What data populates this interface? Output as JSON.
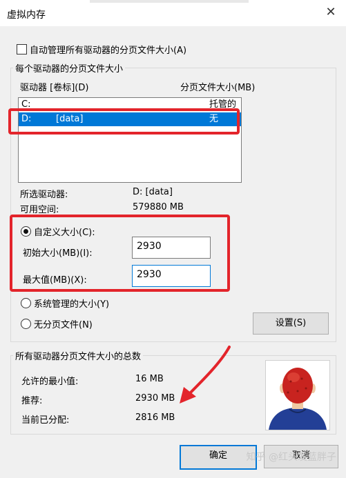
{
  "window": {
    "title": "虚拟内存",
    "close_glyph": "✕"
  },
  "auto_manage": {
    "label": "自动管理所有驱动器的分页文件大小(A)",
    "checked": false
  },
  "per_drive_group": {
    "title": "每个驱动器的分页文件大小",
    "columns": {
      "drive": "驱动器 [卷标](D)",
      "size": "分页文件大小(MB)"
    },
    "drives": [
      {
        "drive": "C:",
        "label": "",
        "size": "托管的系统",
        "selected": false
      },
      {
        "drive": "D:",
        "label": "[data]",
        "size": "无",
        "selected": true
      }
    ],
    "selected_drive": {
      "label": "所选驱动器:",
      "value": "D:  [data]"
    },
    "free_space": {
      "label": "可用空间:",
      "value": "579880 MB"
    },
    "custom_size": {
      "label": "自定义大小(C):",
      "checked": true
    },
    "initial_size": {
      "label": "初始大小(MB)(I):",
      "value": "2930"
    },
    "max_size": {
      "label": "最大值(MB)(X):",
      "value": "2930"
    },
    "system_managed": {
      "label": "系统管理的大小(Y)",
      "checked": false
    },
    "no_paging": {
      "label": "无分页文件(N)",
      "checked": false
    },
    "set_button": "设置(S)"
  },
  "totals_group": {
    "title": "所有驱动器分页文件大小的总数",
    "min_allowed": {
      "label": "允许的最小值:",
      "value": "16 MB"
    },
    "recommended": {
      "label": "推荐:",
      "value": "2930 MB"
    },
    "allocated": {
      "label": "当前已分配:",
      "value": "2816 MB"
    }
  },
  "buttons": {
    "ok": "确定",
    "cancel": "取消"
  },
  "watermark": "知乎 @红头发蓝胖子",
  "colors": {
    "highlight_red": "#e3242b",
    "selection_blue": "#0078d7"
  }
}
